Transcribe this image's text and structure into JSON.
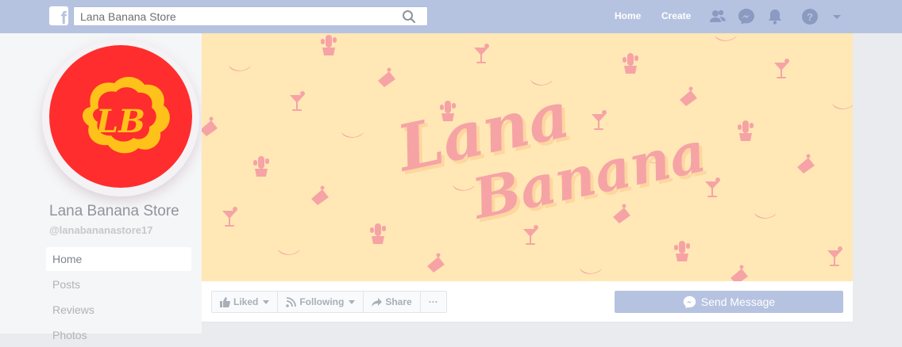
{
  "topbar": {
    "search_value": "Lana Banana Store",
    "nav": {
      "home": "Home",
      "create": "Create"
    },
    "icons": [
      "facebook-logo-icon",
      "search-icon",
      "friends-icon",
      "messenger-icon",
      "notifications-icon",
      "help-icon",
      "account-menu-chevron-icon"
    ],
    "color": "#b6c3e0"
  },
  "page": {
    "name": "Lana Banana Store",
    "handle": "@lanabananastore17",
    "avatar_color": "#ff2d2d",
    "avatar_monogram_color": "#ffc21a"
  },
  "sidebar": {
    "items": [
      {
        "label": "Home",
        "active": true
      },
      {
        "label": "Posts",
        "active": false
      },
      {
        "label": "Reviews",
        "active": false
      },
      {
        "label": "Photos",
        "active": false
      }
    ]
  },
  "cover": {
    "background": "#ffe8b5",
    "accent": "#f6a3a6",
    "icons": [
      "cactus-icon",
      "cocktail-icon",
      "banana-icon",
      "cake-slice-icon"
    ]
  },
  "actions": {
    "liked": "Liked",
    "following": "Following",
    "share": "Share",
    "more": "···",
    "send_message": "Send Message"
  }
}
